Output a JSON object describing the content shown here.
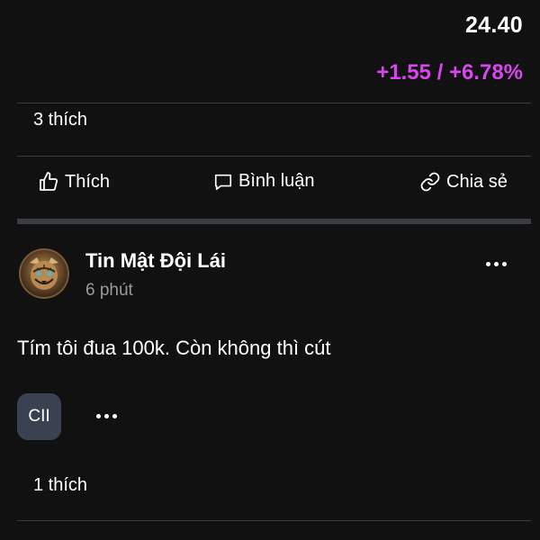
{
  "quote": {
    "price": "24.40",
    "change": "+1.55 / +6.78%"
  },
  "post_above": {
    "likes": "3 thích"
  },
  "actions": {
    "like_label": "Thích",
    "comment_label": "Bình luận",
    "share_label": "Chia sẻ"
  },
  "post": {
    "author": "Tin Mật Đội Lái",
    "time": "6 phút",
    "text": "Tím tôi đua 100k. Còn không thì cút",
    "ticker": "CII",
    "likes": "1 thích"
  },
  "colors": {
    "background": "#111111",
    "accent_change": "#d946ef",
    "chip_bg": "#3a4150"
  },
  "icons": [
    "thumbs-up-icon",
    "comment-icon",
    "link-icon",
    "more-icon",
    "avatar-tiger"
  ]
}
